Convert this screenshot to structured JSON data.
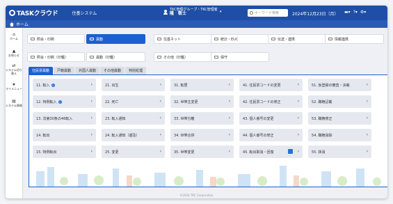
{
  "app": {
    "logo_text": "TASKクラウド",
    "system_name": "住基システム"
  },
  "user": {
    "org": "TKC管理グループ・TKC管理者",
    "name": "隆　敬士"
  },
  "search": {
    "placeholder": "キーワード検索"
  },
  "date_text": "2024年12月23日（月）",
  "breadcrumb": {
    "home": "ホーム"
  },
  "sidebar": {
    "items": [
      {
        "label": "ホーム",
        "icon": "home-icon"
      },
      {
        "label": "お知らせ",
        "icon": "bell-icon"
      },
      {
        "label": "システム切り替え",
        "icon": "switch-icon"
      },
      {
        "label": "マイメニュー",
        "icon": "star-icon"
      },
      {
        "label": "システム情報",
        "icon": "system-info-icon"
      }
    ]
  },
  "menus": {
    "row1": [
      "照会・印刷",
      "異動",
      "住基ネット",
      "統計・EUC",
      "伝送・連携",
      "情報連携"
    ],
    "row2": [
      "照会・印刷（印鑑）",
      "異動（印鑑）",
      "その他（印鑑）",
      "保守"
    ]
  },
  "tabs": [
    "住民票異動",
    "戸籍異動",
    "外国人異動",
    "その他異動",
    "特別処理"
  ],
  "cards": [
    [
      "11. 転入",
      "21. 出生",
      "31. 転居",
      "41. 住民票コードの変更",
      "51. 仮登録の審査・決裁"
    ],
    [
      "12. 特例転入",
      "22. 死亡",
      "32. 世帯主変更",
      "42. 住民票コードの修正",
      "52. 職権記載"
    ],
    [
      "13. 法第30条の46転入",
      "23. 転入通知",
      "33. 世帯分離",
      "43. 個人番号の変更",
      "53. 職権修正"
    ],
    [
      "14. 転出",
      "24. 転入通知（遡及）",
      "34. 世帯合併",
      "44. 個人番号の修正",
      "54. 職権消除"
    ],
    [
      "15. 特例転出",
      "25. 変更",
      "35. 世帯変更",
      "45. 転出取消・回復",
      "55. 抹消"
    ]
  ],
  "footer": "©2024 TKC Corporation",
  "colors": {
    "primary": "#1e4ea6",
    "accent": "#1e5fd0",
    "card": "#e5e8ef"
  }
}
